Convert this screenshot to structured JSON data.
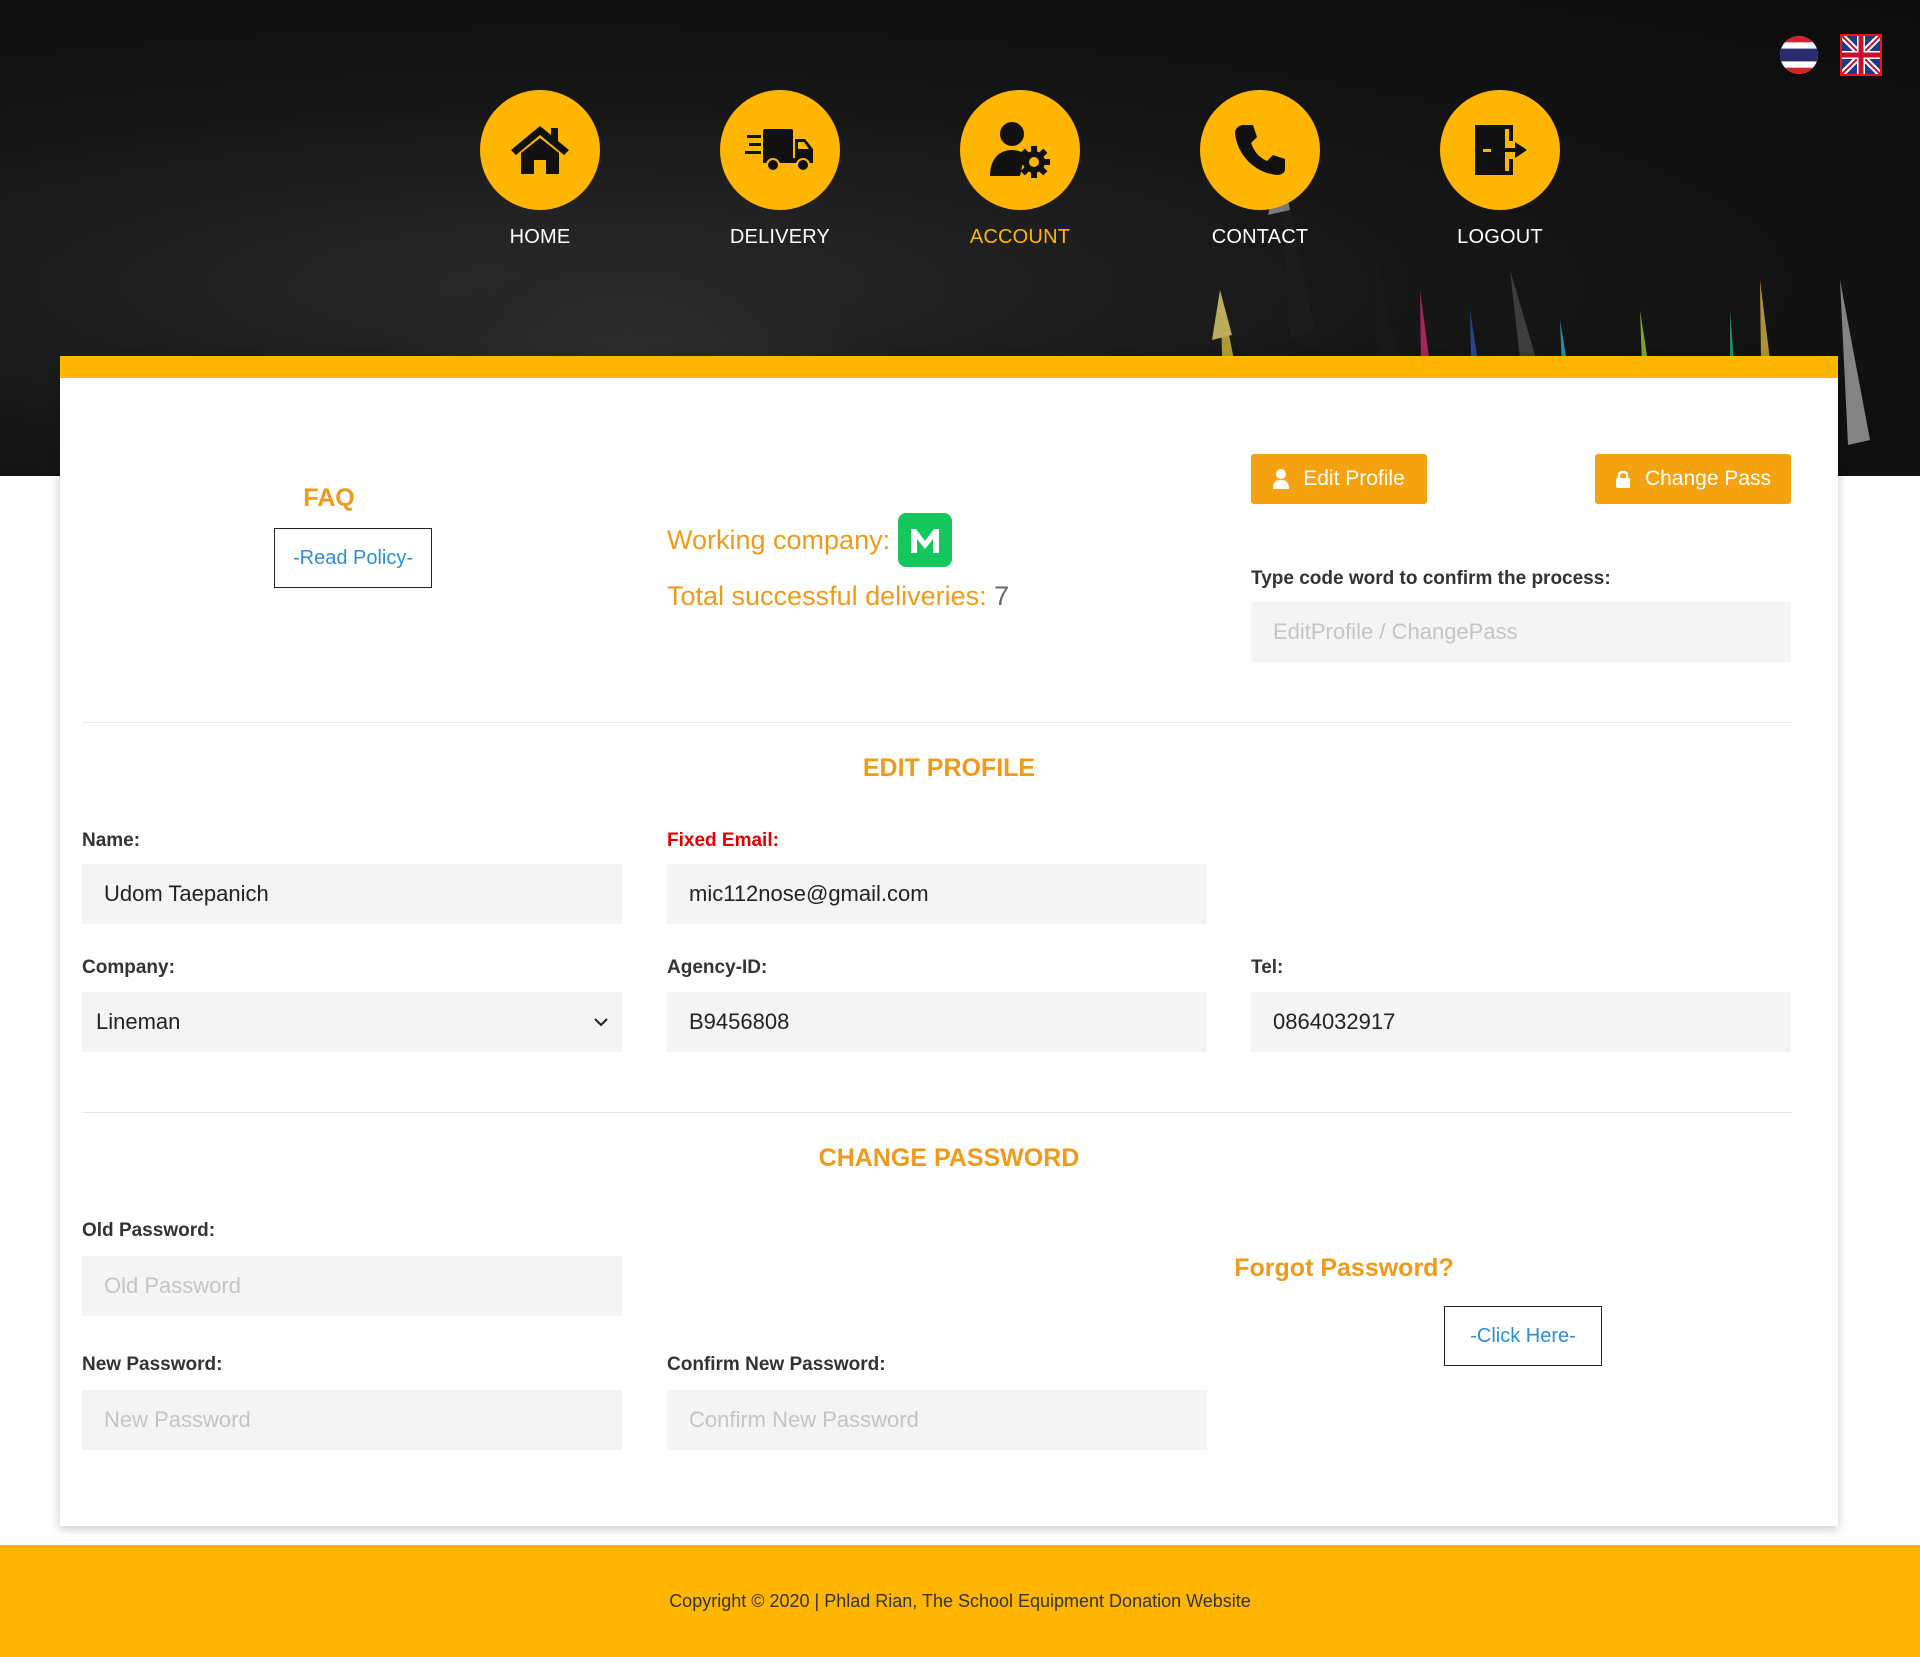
{
  "languages": {
    "thai": "Thai language",
    "english": "English language"
  },
  "nav": {
    "home": "HOME",
    "delivery": "DELIVERY",
    "account": "ACCOUNT",
    "contact": "CONTACT",
    "logout": "LOGOUT",
    "active": "account"
  },
  "faq": {
    "title": "FAQ",
    "read_policy": "-Read Policy-"
  },
  "stats": {
    "working_company_label": "Working company:",
    "deliveries_label": "Total successful deliveries:",
    "deliveries_count": "7"
  },
  "actions": {
    "edit_profile": "Edit Profile",
    "change_pass": "Change Pass",
    "code_word_label": "Type code word to confirm the process:",
    "code_word_placeholder": "EditProfile / ChangePass"
  },
  "edit_profile": {
    "title": "EDIT PROFILE",
    "name_label": "Name:",
    "name_value": "Udom Taepanich",
    "email_label": "Fixed Email:",
    "email_value": "mic112nose@gmail.com",
    "company_label": "Company:",
    "company_value": "Lineman",
    "agency_label": "Agency-ID:",
    "agency_value": "B9456808",
    "tel_label": "Tel:",
    "tel_value": "0864032917"
  },
  "change_password": {
    "title": "CHANGE PASSWORD",
    "old_label": "Old Password:",
    "old_placeholder": "Old Password",
    "new_label": "New Password:",
    "new_placeholder": "New Password",
    "confirm_label": "Confirm New Password:",
    "confirm_placeholder": "Confirm New Password",
    "forgot_title": "Forgot Password?",
    "click_here": "-Click Here-"
  },
  "footer": {
    "copyright": "Copyright © 2020 | Phlad Rian, The School Equipment Donation Website"
  },
  "colors": {
    "accent": "#ffb600",
    "button": "#f4a20f",
    "heading": "#ef9a1a",
    "link": "#2f8dd6",
    "alert": "#e10000",
    "lineman_green": "#14c85e"
  }
}
